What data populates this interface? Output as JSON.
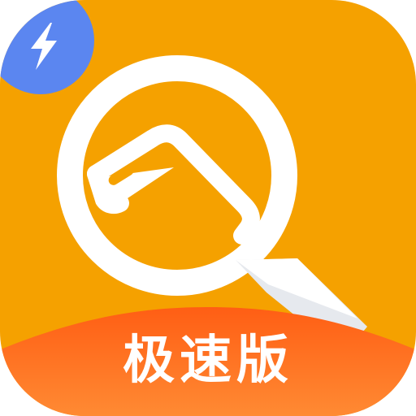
{
  "icon": {
    "caption": "极速版",
    "primary_icon": "magnifier-q-icon",
    "badge_icon": "lightning-bolt-icon"
  },
  "colors": {
    "background": "#F5A100",
    "bottom_band": "#FF6A1A",
    "badge": "#5B86F0",
    "glyph": "#FFFFFF",
    "glyph_shade": "#E6E9EE"
  }
}
